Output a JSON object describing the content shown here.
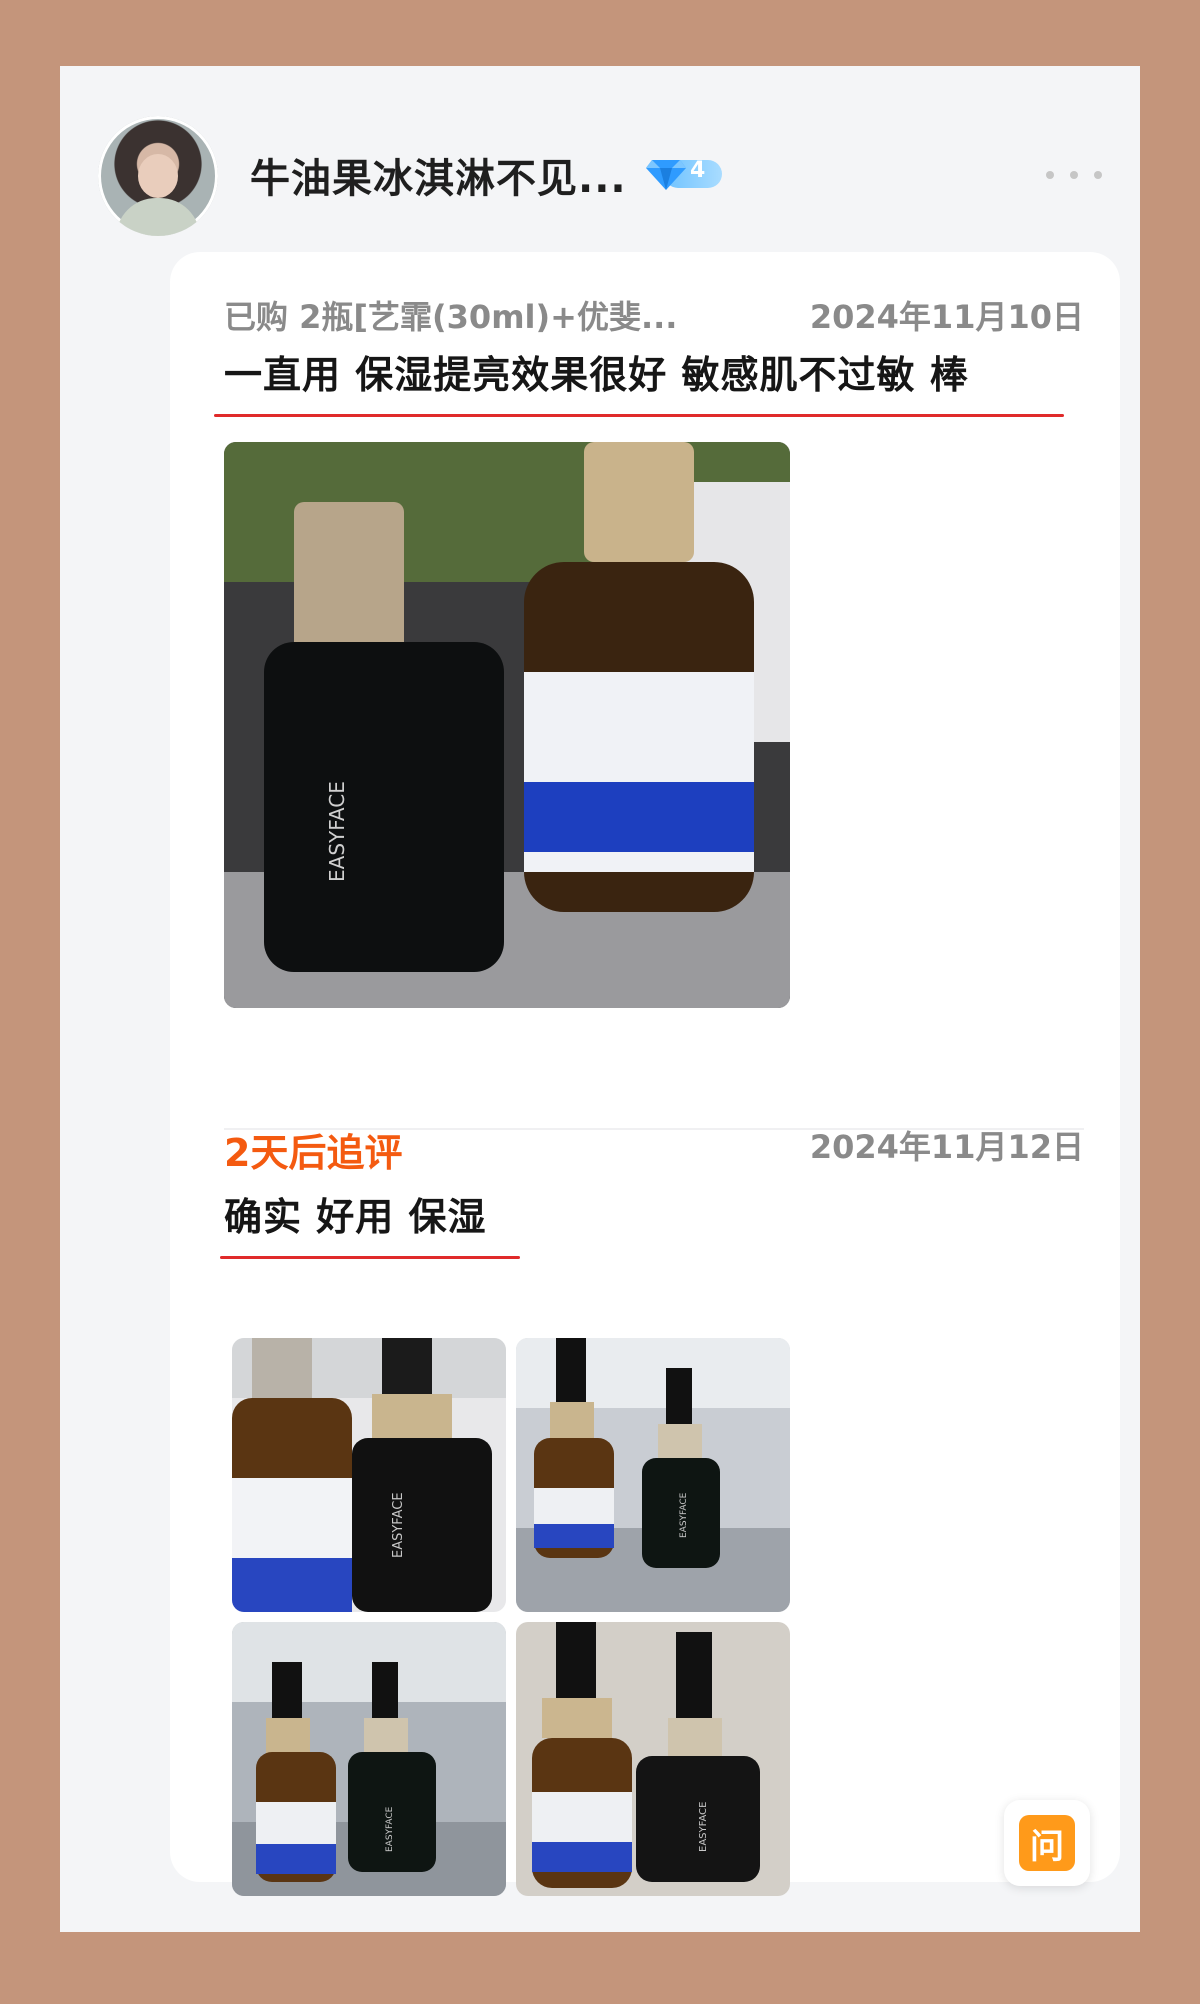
{
  "user": {
    "name": "牛油果冰淇淋不见...",
    "vip_level": "4"
  },
  "review": {
    "purchase": "已购 2瓶[艺霏(30ml)+优斐...",
    "date": "2024年11月10日",
    "text": "一直用 保湿提亮效果很好 敏感肌不过敏 棒",
    "photos": [
      {
        "caption": "",
        "label": "EASYFACE"
      }
    ]
  },
  "followup": {
    "label": "2天后追评",
    "date": "2024年11月12日",
    "text": "确实 好用 保湿",
    "photos": [
      {
        "label": "EASYFACE"
      },
      {
        "label": "EASYFACE"
      },
      {
        "label": "EASYFACE"
      },
      {
        "label": "EASYFACE"
      }
    ]
  },
  "ask_button": {
    "label": "问"
  },
  "colors": {
    "background": "#c4957b",
    "accent_orange": "#f45a10",
    "underline_red": "#e02a2a",
    "ask_orange": "#ff9a1a"
  }
}
